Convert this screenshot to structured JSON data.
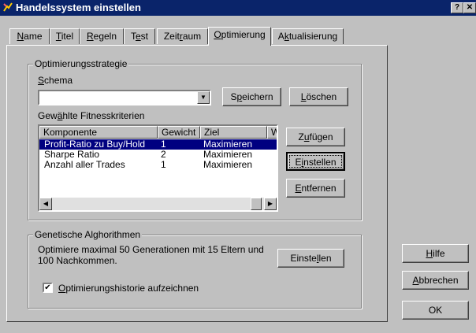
{
  "window": {
    "title": "Handelssystem einstellen",
    "help_btn": "?",
    "close_btn": "✕"
  },
  "tabs": [
    {
      "label": "Name",
      "u": "N",
      "rest": "ame"
    },
    {
      "label": "Titel",
      "u": "T",
      "rest": "itel"
    },
    {
      "label": "Regeln",
      "u": "R",
      "rest": "egeln"
    },
    {
      "label": "Test",
      "pre": "T",
      "u": "e",
      "rest": "st"
    },
    {
      "label": "Zeitraum",
      "pre": "Zeit",
      "u": "r",
      "rest": "aum"
    },
    {
      "label": "Optimierung",
      "u": "O",
      "rest": "ptimierung"
    },
    {
      "label": "Aktualisierung",
      "pre": "A",
      "u": "k",
      "rest": "tualisierung"
    }
  ],
  "optim": {
    "group_label": "Optimierungsstrategie",
    "schema_label_u": "S",
    "schema_label_rest": "chema",
    "schema_value": "",
    "save_pre": "S",
    "save_u": "p",
    "save_rest": "eichern",
    "delete_u": "L",
    "delete_rest": "öschen",
    "fitness_label_pre": "Gew",
    "fitness_label_u": "ä",
    "fitness_label_rest": "hlte Fitnesskriterien",
    "columns": [
      "Komponente",
      "Gewicht",
      "Ziel",
      "W"
    ],
    "rows": [
      {
        "komponente": "Profit-Ratio zu Buy/Hold",
        "gewicht": "1",
        "ziel": "Maximieren"
      },
      {
        "komponente": "Sharpe Ratio",
        "gewicht": "2",
        "ziel": "Maximieren"
      },
      {
        "komponente": "Anzahl aller Trades",
        "gewicht": "1",
        "ziel": "Maximieren"
      }
    ],
    "add_pre": "Z",
    "add_u": "u",
    "add_rest": "fügen",
    "set_pre": "E",
    "set_u": "i",
    "set_rest": "nstellen",
    "remove_u": "E",
    "remove_rest": "ntfernen"
  },
  "genetic": {
    "group_label": "Genetische Alghorithmen",
    "text_line1": "Optimiere maximal 50 Generationen mit 15 Eltern und",
    "text_line2": "100 Nachkommen.",
    "set_pre": "Einste",
    "set_u": "l",
    "set_rest": "len",
    "history_checked": "✔",
    "history_u": "O",
    "history_rest": "ptimierungshistorie aufzeichnen"
  },
  "side_buttons": {
    "help_u": "H",
    "help_rest": "ilfe",
    "cancel_u": "A",
    "cancel_rest": "bbrechen",
    "ok": "OK"
  }
}
